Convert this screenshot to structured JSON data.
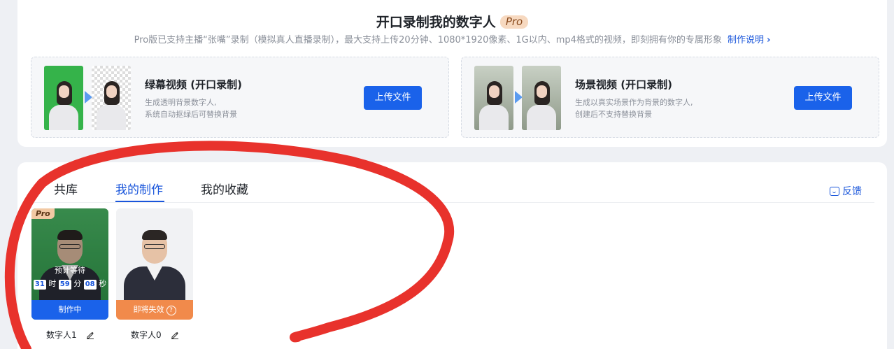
{
  "hero": {
    "title": "开口录制我的数字人",
    "pro_badge": "Pro",
    "subtitle": "Pro版已支持主播“张嘴”录制（模拟真人直播录制），最大支持上传20分钟、1080*1920像素、1G以内、mp4格式的视频，即刻拥有你的专属形象",
    "help_link": "制作说明"
  },
  "modes": [
    {
      "title": "绿幕视频 (开口录制)",
      "desc_line1": "生成透明背景数字人,",
      "desc_line2": "系统自动抠绿后可替换背景",
      "button": "上传文件"
    },
    {
      "title": "场景视频 (开口录制)",
      "desc_line1": "生成以真实场景作为背景的数字人,",
      "desc_line2": "创建后不支持替换背景",
      "button": "上传文件"
    }
  ],
  "tabs": [
    {
      "label": "共库",
      "active": false
    },
    {
      "label": "我的制作",
      "active": true
    },
    {
      "label": "我的收藏",
      "active": false
    }
  ],
  "feedback": "反馈",
  "avatars": [
    {
      "name": "数字人1",
      "badge": "Pro",
      "wait_label": "预计等待",
      "countdown": {
        "hours": "31",
        "h_unit": "时",
        "minutes": "59",
        "m_unit": "分",
        "seconds": "08",
        "s_unit": "秒"
      },
      "status": "制作中"
    },
    {
      "name": "数字人0",
      "status": "即将失效",
      "status_icon": "?"
    }
  ],
  "colors": {
    "accent": "#1a62ea",
    "status_expiring": "#f18a4b",
    "green_screen": "#35b34a",
    "annotation_red": "#e8322c"
  },
  "icons": [
    "chevron-right-icon",
    "feedback-icon",
    "edit-icon",
    "question-icon",
    "arrow-right-icon"
  ]
}
